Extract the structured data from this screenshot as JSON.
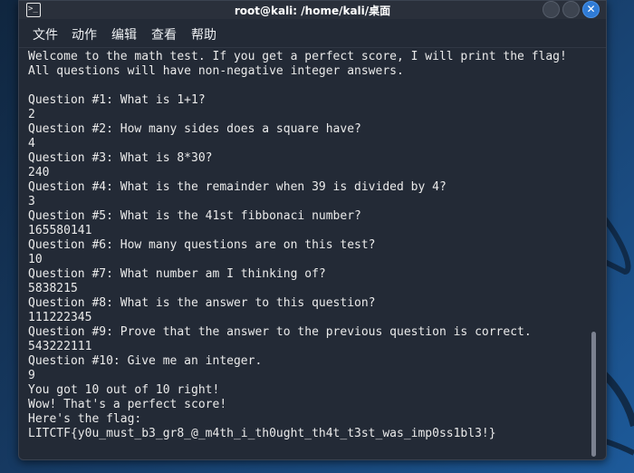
{
  "window": {
    "title": "root@kali: /home/kali/桌面",
    "app_icon_glyph": ">_",
    "close_glyph": "✕"
  },
  "menu": {
    "items": [
      "文件",
      "动作",
      "编辑",
      "查看",
      "帮助"
    ]
  },
  "terminal": {
    "lines": [
      "Welcome to the math test. If you get a perfect score, I will print the flag!",
      "All questions will have non-negative integer answers.",
      "",
      "Question #1: What is 1+1?",
      "2",
      "Question #2: How many sides does a square have?",
      "4",
      "Question #3: What is 8*30?",
      "240",
      "Question #4: What is the remainder when 39 is divided by 4?",
      "3",
      "Question #5: What is the 41st fibbonaci number?",
      "165580141",
      "Question #6: How many questions are on this test?",
      "10",
      "Question #7: What number am I thinking of?",
      "5838215",
      "Question #8: What is the answer to this question?",
      "111222345",
      "Question #9: Prove that the answer to the previous question is correct.",
      "543222111",
      "Question #10: Give me an integer.",
      "9",
      "You got 10 out of 10 right!",
      "Wow! That's a perfect score!",
      "Here's the flag:",
      "LITCTF{y0u_must_b3_gr8_@_m4th_i_th0ught_th4t_t3st_was_imp0ss1bl3!}"
    ]
  },
  "colors": {
    "terminal_bg": "#232a36",
    "terminal_text": "#eaeaea",
    "accent": "#2f7bd6"
  }
}
